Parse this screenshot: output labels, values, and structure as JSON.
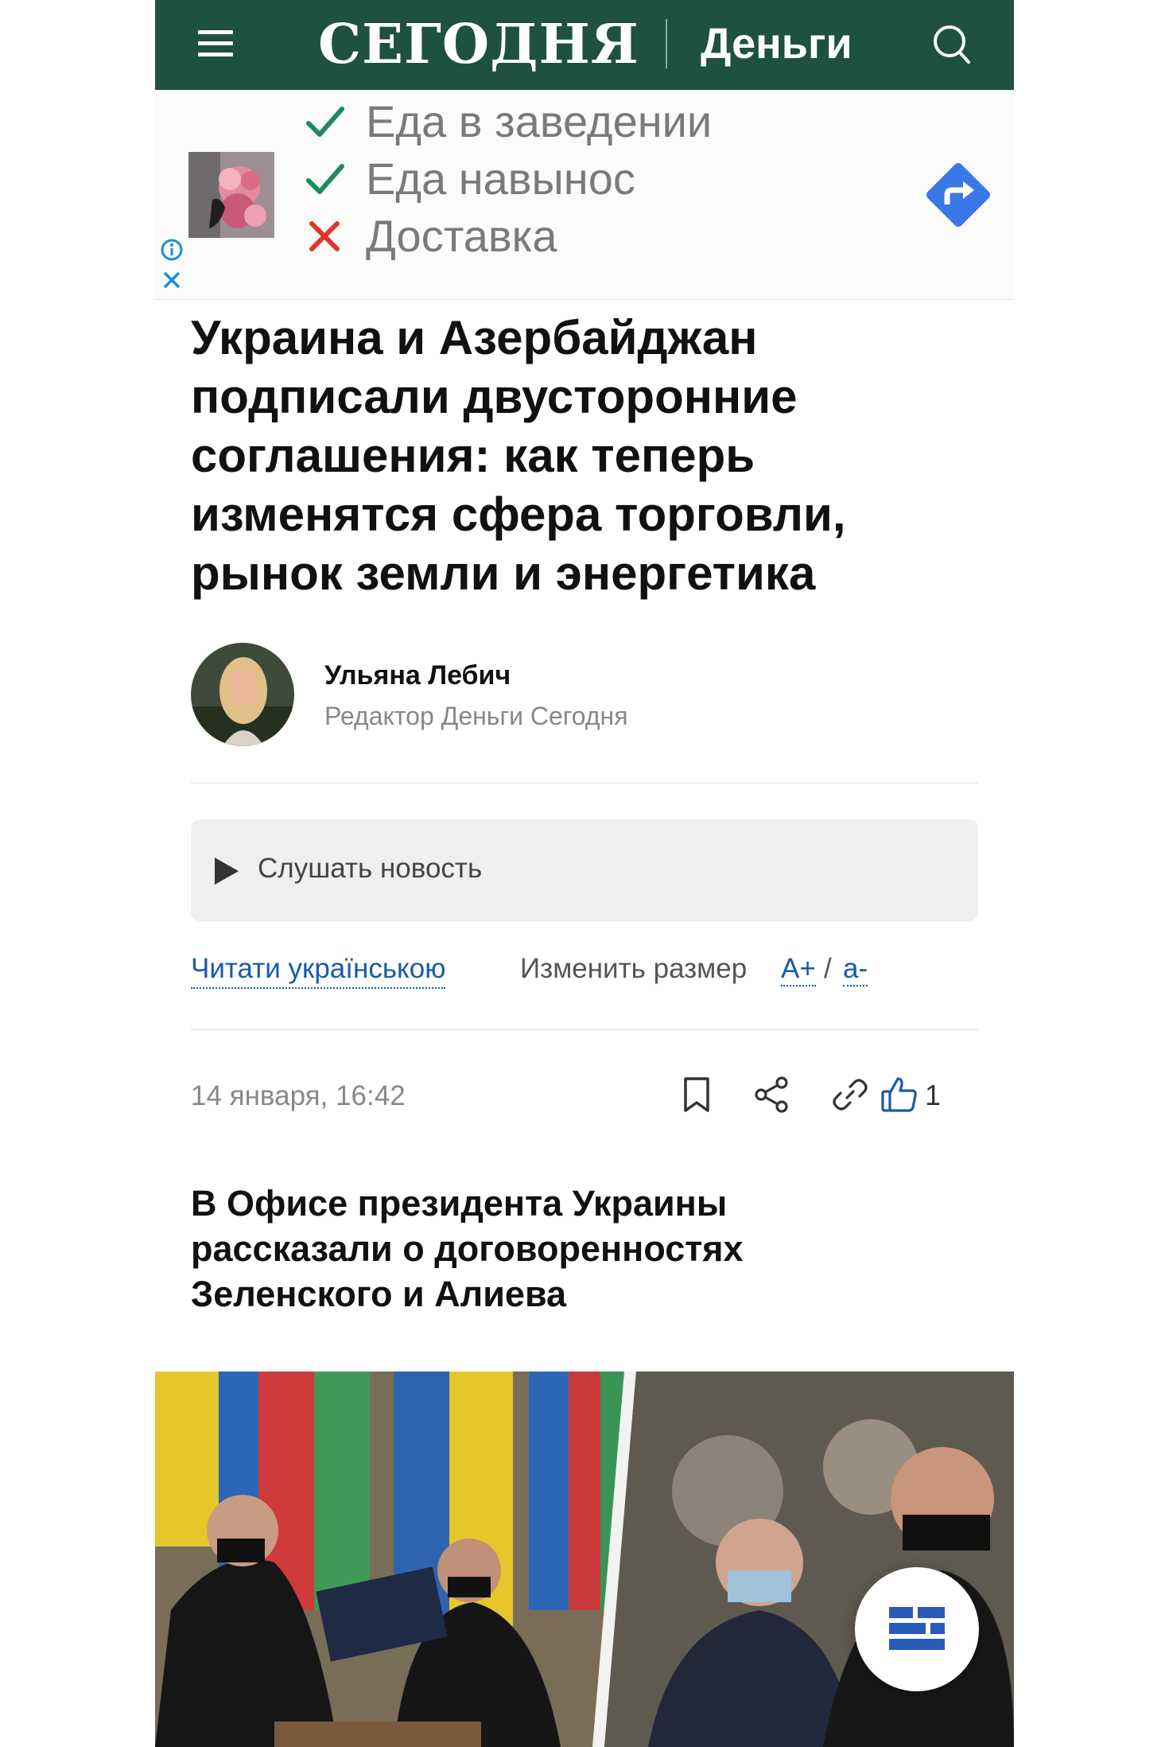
{
  "header": {
    "logo": "СЕГОДНЯ",
    "section": "Деньги"
  },
  "ad": {
    "items": [
      {
        "label": "Еда в заведении",
        "status": "yes"
      },
      {
        "label": "Еда навынос",
        "status": "yes"
      },
      {
        "label": "Доставка",
        "status": "no"
      }
    ]
  },
  "article": {
    "title": "Украина и Азербайджан подписали двусторонние соглашения: как теперь изменятся сфера торговли, рынок земли и энергетика",
    "author": {
      "name": "Ульяна Лебич",
      "role": "Редактор Деньги Сегодня"
    },
    "listen_label": "Слушать новость",
    "read_ukrainian": "Читати українською",
    "resize_label": "Изменить размер",
    "font_plus": "A+",
    "font_sep": "/",
    "font_minus": "a-",
    "date": "14 января, 16:42",
    "likes": "1",
    "subtitle": "В Офисе президента Украины рассказали о договоренностях Зеленского и Алиева"
  },
  "colors": {
    "header_bg": "#1e5140",
    "link": "#1a5aa8",
    "check": "#1f8a5b",
    "cross": "#e0352b",
    "ad_arrow": "#3b78e7"
  },
  "icons": [
    "menu-icon",
    "search-icon",
    "check-icon",
    "cross-icon",
    "info-icon",
    "close-icon",
    "directions-icon",
    "play-icon",
    "bookmark-icon",
    "share-icon",
    "link-icon",
    "like-icon",
    "news-feed-icon"
  ]
}
